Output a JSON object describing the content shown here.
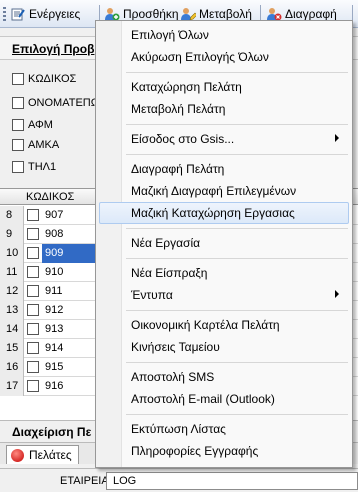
{
  "toolbar": {
    "actions": "Ενέργειες",
    "add": "Προσθήκη",
    "edit": "Μεταβολή",
    "delete": "Διαγραφή"
  },
  "panel": {
    "title": "Επιλογή Προβ",
    "filters": [
      "ΚΩΔΙΚΟΣ",
      "ΟΝΟΜΑΤΕΠΩ",
      "ΑΦΜ",
      "ΑΜΚΑ",
      "ΤΗΛ1"
    ]
  },
  "grid": {
    "header": "ΚΩΔΙΚΟΣ",
    "rows": [
      {
        "num": "8",
        "code": "907"
      },
      {
        "num": "9",
        "code": "908"
      },
      {
        "num": "10",
        "code": "909"
      },
      {
        "num": "11",
        "code": "910"
      },
      {
        "num": "12",
        "code": "911"
      },
      {
        "num": "13",
        "code": "912"
      },
      {
        "num": "14",
        "code": "913"
      },
      {
        "num": "15",
        "code": "914"
      },
      {
        "num": "16",
        "code": "915"
      },
      {
        "num": "17",
        "code": "916"
      }
    ]
  },
  "bottom": {
    "title": "Διαχείριση Πε",
    "tab": "Πελάτες",
    "company_label": "ΕΤΑΙΡΕΙΑ:",
    "company_value": "LOG"
  },
  "menu": {
    "items": [
      "Επιλογή Όλων",
      "Ακύρωση Επιλογής Όλων",
      "Καταχώρηση Πελάτη",
      "Μεταβολή Πελάτη",
      "Είσοδος στο Gsis...",
      "Διαγραφή Πελάτη",
      "Μαζική Διαγραφή Επιλεγμένων",
      "Μαζική Καταχώρηση Εργασιας",
      "Νέα Εργασία",
      "Νέα Είσπραξη",
      "Έντυπα",
      "Οικονομική Καρτέλα Πελάτη",
      "Κινήσεις Ταμείου",
      "Αποστολή SMS",
      "Αποστολή E-mail (Outlook)",
      "Εκτύπωση Λίστας",
      "Πληροφορίες Εγγραφής"
    ]
  }
}
